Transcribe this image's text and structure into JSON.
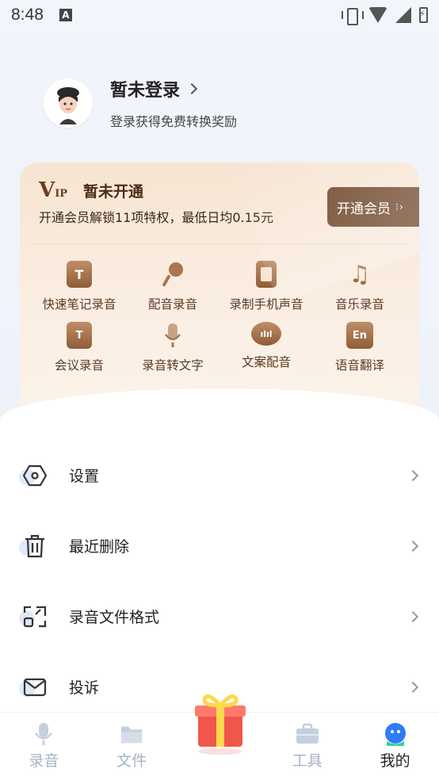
{
  "status_bar": {
    "time": "8:48",
    "a_badge": "A"
  },
  "profile": {
    "name": "暂未登录",
    "subtitle": "登录获得免费转换奖励"
  },
  "vip": {
    "logo": "V",
    "logo_small": "IP",
    "status": "暂未开通",
    "description": "开通会员解锁11项特权，最低日均0.15元",
    "button_label": "开通会员",
    "features": [
      {
        "label": "快速笔记录音",
        "icon": "text-t-icon",
        "glyph": "T"
      },
      {
        "label": "配音录音",
        "icon": "microphone-icon",
        "glyph": ""
      },
      {
        "label": "录制手机声音",
        "icon": "phone-icon",
        "glyph": ""
      },
      {
        "label": "音乐录音",
        "icon": "music-note-icon",
        "glyph": "♫"
      },
      {
        "label": "会议录音",
        "icon": "meeting-icon",
        "glyph": "T"
      },
      {
        "label": "录音转文字",
        "icon": "mic-to-text-icon",
        "glyph": ""
      },
      {
        "label": "文案配音",
        "icon": "waveform-bubble-icon",
        "glyph": "ılıl"
      },
      {
        "label": "语音翻译",
        "icon": "translate-en-icon",
        "glyph": "En"
      }
    ]
  },
  "menu": [
    {
      "label": "设置",
      "icon": "settings-hexagon-icon"
    },
    {
      "label": "最近删除",
      "icon": "trash-icon"
    },
    {
      "label": "录音文件格式",
      "icon": "file-format-icon"
    },
    {
      "label": "投诉",
      "icon": "mail-icon"
    }
  ],
  "nav": [
    {
      "label": "录音",
      "icon": "microphone-icon"
    },
    {
      "label": "文件",
      "icon": "folder-icon"
    },
    {
      "label": "",
      "icon": "gift-icon"
    },
    {
      "label": "工具",
      "icon": "toolbox-icon"
    },
    {
      "label": "我的",
      "icon": "profile-icon"
    }
  ],
  "colors": {
    "accent_brown": "#6d4427",
    "vip_text": "#5a3a20",
    "nav_inactive": "#a5b3c8",
    "nav_active_icon": "#2f7cf6"
  }
}
